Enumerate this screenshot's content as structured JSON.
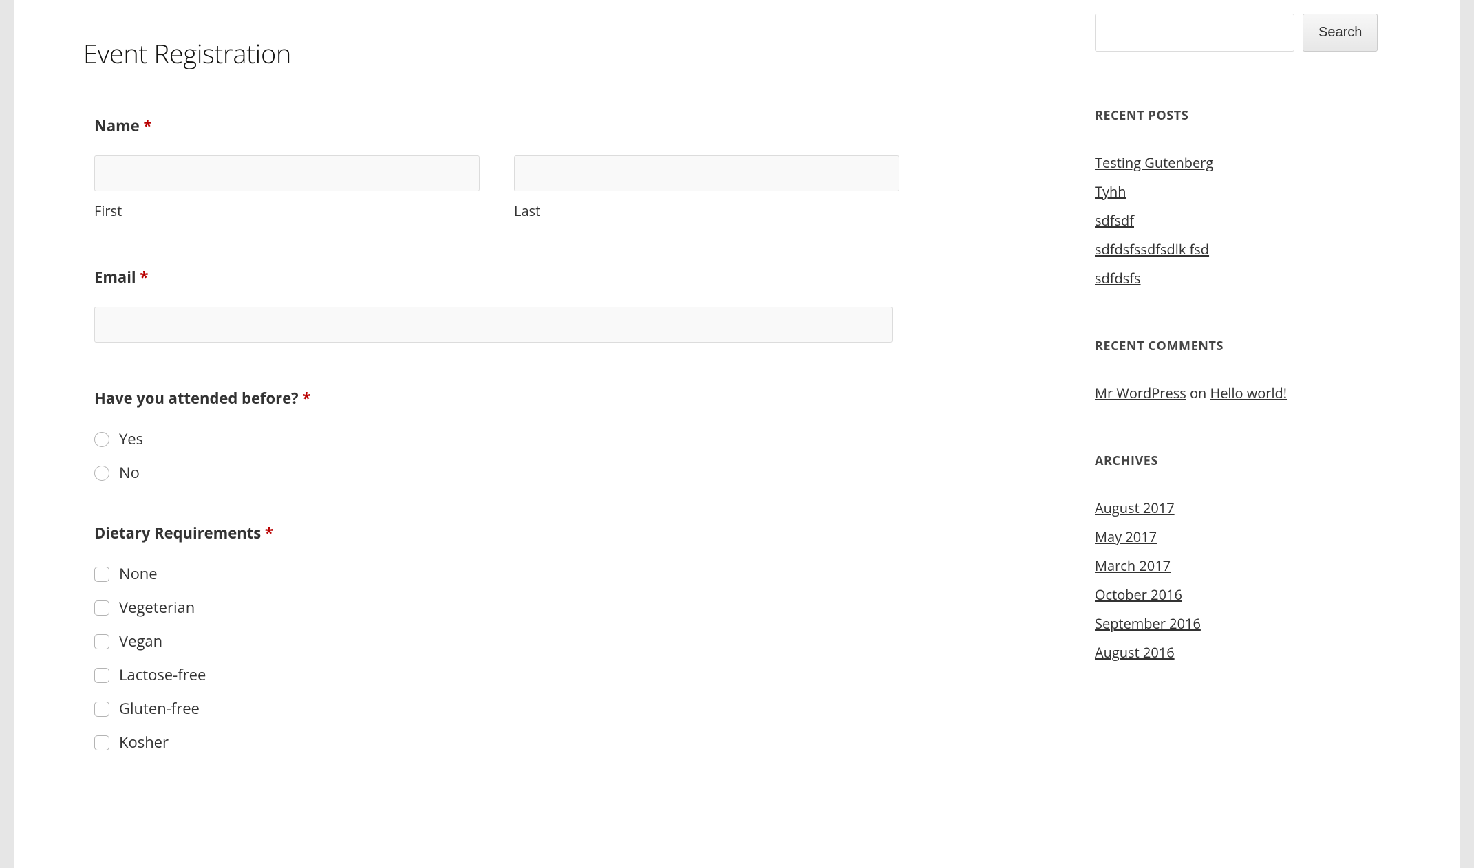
{
  "main": {
    "page_title": "Event Registration",
    "fields": {
      "name": {
        "label": "Name ",
        "required": true,
        "first_value": "",
        "last_value": "",
        "first_sublabel": "First",
        "last_sublabel": "Last"
      },
      "email": {
        "label": "Email ",
        "required": true,
        "value": ""
      },
      "attended": {
        "label": "Have you attended before? ",
        "required": true,
        "options": [
          "Yes",
          "No"
        ]
      },
      "dietary": {
        "label": "Dietary Requirements ",
        "required": true,
        "options": [
          "None",
          "Vegeterian",
          "Vegan",
          "Lactose-free",
          "Gluten-free",
          "Kosher"
        ]
      }
    },
    "required_marker": "*"
  },
  "sidebar": {
    "search": {
      "value": "",
      "button_label": "Search"
    },
    "recent_posts": {
      "title": "RECENT POSTS",
      "items": [
        "Testing Gutenberg",
        "Tyhh",
        "sdfsdf",
        "sdfdsfssdfsdlk fsd",
        "sdfdsfs"
      ]
    },
    "recent_comments": {
      "title": "RECENT COMMENTS",
      "author": "Mr WordPress",
      "connector": " on ",
      "post": "Hello world!"
    },
    "archives": {
      "title": "ARCHIVES",
      "items": [
        "August 2017",
        "May 2017",
        "March 2017",
        "October 2016",
        "September 2016",
        "August 2016"
      ]
    }
  }
}
